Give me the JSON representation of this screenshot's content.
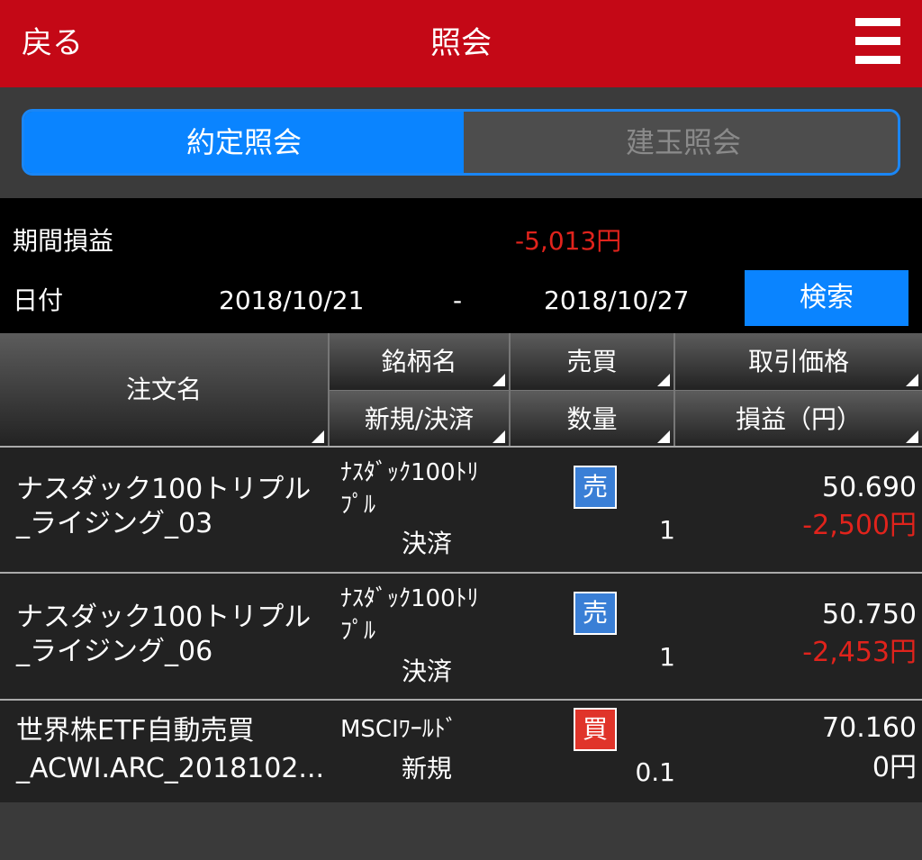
{
  "header": {
    "back_label": "戻る",
    "title": "照会"
  },
  "tabs": [
    {
      "label": "約定照会",
      "active": true
    },
    {
      "label": "建玉照会",
      "active": false
    }
  ],
  "summary": {
    "period_pl_label": "期間損益",
    "period_pl_value": "-5,013円",
    "date_label": "日付",
    "date_from": "2018/10/21",
    "date_separator": "-",
    "date_to": "2018/10/27",
    "search_label": "検索"
  },
  "table_headers": {
    "order_name": "注文名",
    "symbol": "銘柄名",
    "side": "売買",
    "price": "取引価格",
    "new_close": "新規/決済",
    "quantity": "数量",
    "pl": "損益（円）"
  },
  "rows": [
    {
      "order_line1": "ナスダック100トリプル",
      "order_line2": "_ライジング_03",
      "symbol_line1": "ﾅｽﾀﾞｯｸ100ﾄﾘ",
      "symbol_line2": "ﾌﾟﾙ",
      "kind": "決済",
      "side": "売",
      "quantity": "1",
      "price": "50.690",
      "pl": "-2,500円"
    },
    {
      "order_line1": "ナスダック100トリプル",
      "order_line2": "_ライジング_06",
      "symbol_line1": "ﾅｽﾀﾞｯｸ100ﾄﾘ",
      "symbol_line2": "ﾌﾟﾙ",
      "kind": "決済",
      "side": "売",
      "quantity": "1",
      "price": "50.750",
      "pl": "-2,453円"
    },
    {
      "order_line1": "世界株ETF自動売買",
      "order_line2": "_ACWI.ARC_2018102...",
      "symbol_line1": "MSCIﾜｰﾙﾄﾞ",
      "symbol_line2": "",
      "kind": "新規",
      "side": "買",
      "quantity": "0.1",
      "price": "70.160",
      "pl": "0円"
    }
  ],
  "colors": {
    "header_bg": "#c40816",
    "accent_blue": "#0a84ff",
    "loss_red": "#e0231c",
    "sell_badge": "#3a7fd6",
    "buy_badge": "#e0342a"
  }
}
